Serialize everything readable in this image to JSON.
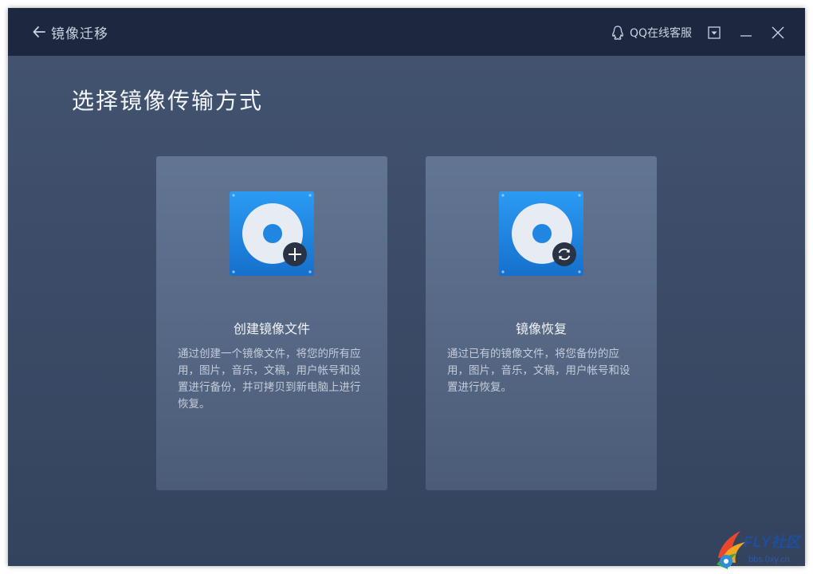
{
  "titlebar": {
    "back_label": "镜像迁移",
    "support_label": "QQ在线客服"
  },
  "page": {
    "title": "选择镜像传输方式"
  },
  "cards": [
    {
      "title": "创建镜像文件",
      "description": "通过创建一个镜像文件，将您的所有应用，图片，音乐，文稿，用户帐号和设置进行备份，并可拷贝到新电脑上进行恢复。",
      "badge_icon": "plus-icon"
    },
    {
      "title": "镜像恢复",
      "description": "通过已有的镜像文件，将您备份的应用，图片，音乐，文稿，用户帐号和设置进行恢复。",
      "badge_icon": "refresh-icon"
    }
  ],
  "watermark": {
    "brand": "FLY社区",
    "site": "bbs.0xy.cn"
  },
  "colors": {
    "titlebar": "#1d2840",
    "window_bg": "#3d4d69",
    "card_bg": "#5a6c89",
    "icon_blue": "#1f8ae6"
  }
}
